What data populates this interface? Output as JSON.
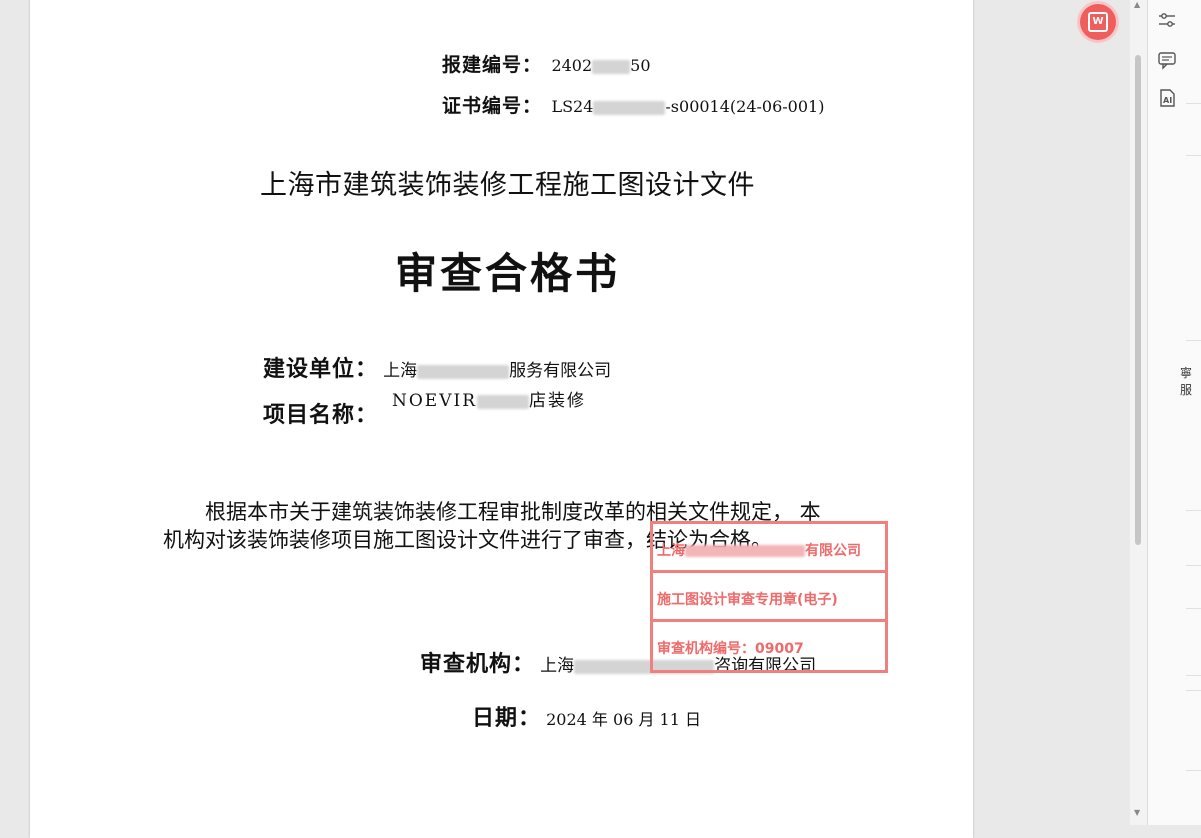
{
  "document": {
    "report_label": "报建编号",
    "report_no_visible": "2402",
    "report_no_tail": "50",
    "cert_label": "证书编号",
    "cert_no_prefix": "LS24",
    "cert_no_suffix": "-s00014(24-06-001)",
    "colon": "：",
    "subtitle": "上海市建筑装饰装修工程施工图设计文件",
    "title": "审查合格书",
    "builder_label": "建设单位",
    "builder_value_start": "上海",
    "builder_value_end": "服务有限公司",
    "project_label": "项目名称",
    "project_value_start": "NOEVIR",
    "project_value_end": "店装修",
    "body_line1": "根据本市关于建筑装饰装修工程审批制度改革的相关文件规定， 本",
    "body_line2": "机构对该装饰装修项目施工图设计文件进行了审查，结论为合格。",
    "reviewer_label": "审查机构",
    "reviewer_value_start": "上海",
    "reviewer_value_end": "咨询有限公司",
    "date_label": "日期",
    "date_value": "2024 年 06 月 11 日"
  },
  "stamp": {
    "line1": "上海",
    "line1_end": "有限公司",
    "line2": "施工图设计审查专用章(电子)",
    "line3": "审查机构编号：09007"
  },
  "sidebar_tools": [
    "settings-sliders-icon",
    "comment-icon",
    "ai-icon"
  ],
  "edge_text": "寧服",
  "colors": {
    "stamp": "#f08080",
    "float_button": "#ef5d5d"
  }
}
